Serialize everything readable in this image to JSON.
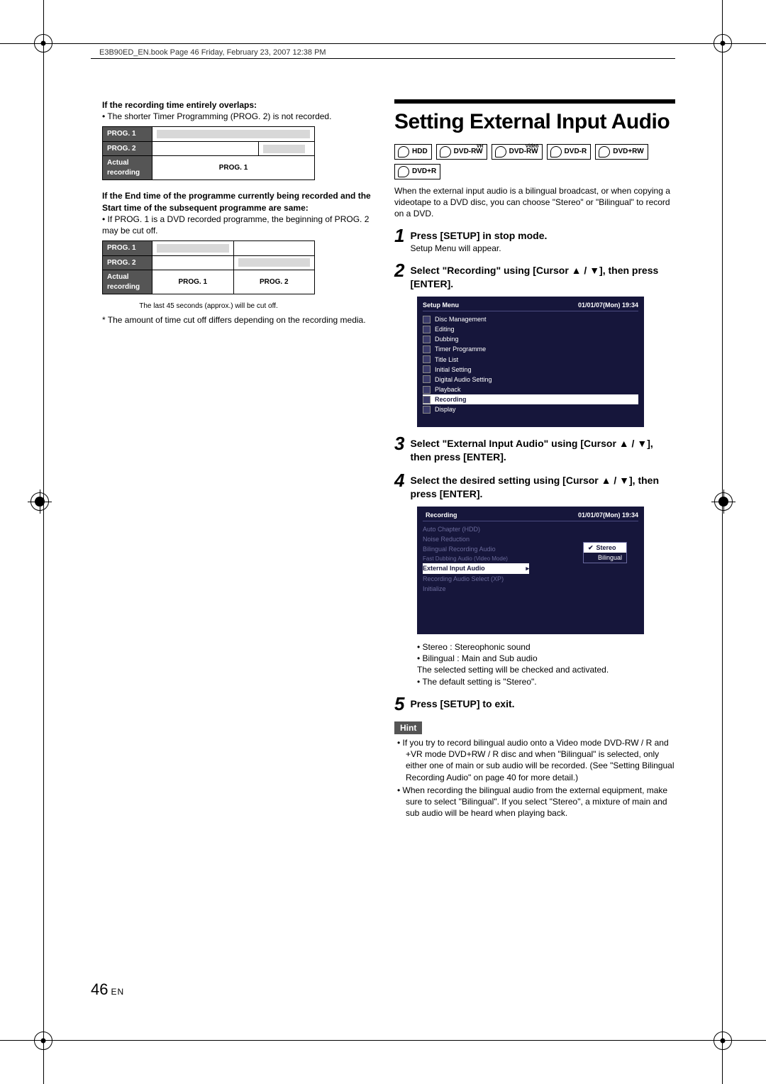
{
  "header": "E3B90ED_EN.book  Page 46  Friday, February 23, 2007  12:38 PM",
  "left": {
    "h1": "If the recording time entirely overlaps:",
    "p1": "• The shorter Timer Programming (PROG. 2) is not recorded.",
    "tbl1": {
      "r1": "PROG. 1",
      "r2": "PROG. 2",
      "r3a": "Actual recording",
      "r3b": "PROG. 1"
    },
    "h2": "If the End time of the programme currently being recorded and the Start time of the subsequent programme are same:",
    "p2": "• If PROG. 1 is a DVD recorded programme, the beginning of PROG. 2 may be cut off.",
    "tbl2": {
      "r1": "PROG. 1",
      "r2": "PROG. 2",
      "r3a": "Actual recording",
      "r3b": "PROG. 1",
      "r3c": "PROG. 2",
      "caption": "The last 45 seconds (approx.) will be cut off."
    },
    "p3": "* The amount of time cut off differs depending on the recording media."
  },
  "right": {
    "h2": "Setting External Input Audio",
    "discs": {
      "hdd": "HDD",
      "dvdrw_vr": "DVD-RW",
      "dvdrw_vr_sup": "VR",
      "dvdrw_video": "DVD-RW",
      "dvdrw_video_sup": "Video",
      "dvdr": "DVD-R",
      "dvdprw": "DVD+RW",
      "dvdpr": "DVD+R"
    },
    "intro": "When the external input audio is a bilingual broadcast, or when copying a videotape to a DVD disc, you can choose \"Stereo\" or \"Bilingual\" to record on a DVD.",
    "steps": {
      "s1": {
        "n": "1",
        "title": "Press [SETUP] in stop mode.",
        "sub": "Setup Menu will appear."
      },
      "s2": {
        "n": "2",
        "title": "Select \"Recording\" using [Cursor ▲ / ▼], then press [ENTER]."
      },
      "s3": {
        "n": "3",
        "title": "Select \"External Input Audio\" using [Cursor ▲ / ▼], then press [ENTER]."
      },
      "s4": {
        "n": "4",
        "title": "Select the desired setting using [Cursor ▲ / ▼], then press [ENTER]."
      },
      "s5": {
        "n": "5",
        "title": "Press [SETUP] to exit."
      }
    },
    "menu1": {
      "title": "Setup Menu",
      "datetime": "01/01/07(Mon)    19:34",
      "items": [
        "Disc Management",
        "Editing",
        "Dubbing",
        "Timer Programme",
        "Title List",
        "Initial Setting",
        "Digital Audio Setting",
        "Playback",
        "Recording",
        "Display"
      ]
    },
    "menu2": {
      "title": "Recording",
      "datetime": "01/01/07(Mon)    19:34",
      "items": [
        "Auto Chapter (HDD)",
        "Noise Reduction",
        "Bilingual Recording Audio",
        "Fast Dubbing Audio (Video Mode)",
        "External Input Audio",
        "Recording Audio Select (XP)",
        "Initialize"
      ],
      "options": [
        "Stereo",
        "Bilingual"
      ]
    },
    "after4": {
      "b1": "• Stereo    : Stereophonic sound",
      "b2": "• Bilingual : Main and Sub audio",
      "b3": "The selected setting will be checked and activated.",
      "b4": "• The default setting is \"Stereo\"."
    },
    "hint": {
      "label": "Hint",
      "p1": "• If you try to record bilingual audio onto a Video mode DVD-RW / R and +VR mode DVD+RW / R disc and when \"Bilingual\" is selected, only either one of main or sub audio will be recorded. (See \"Setting Bilingual Recording Audio\" on page 40 for more detail.)",
      "p2": "• When recording the bilingual audio from the external equipment, make sure to select \"Bilingual\". If you select \"Stereo\", a mixture of main and sub audio will be heard when playing back."
    }
  },
  "page": {
    "num": "46",
    "lang": "EN"
  }
}
